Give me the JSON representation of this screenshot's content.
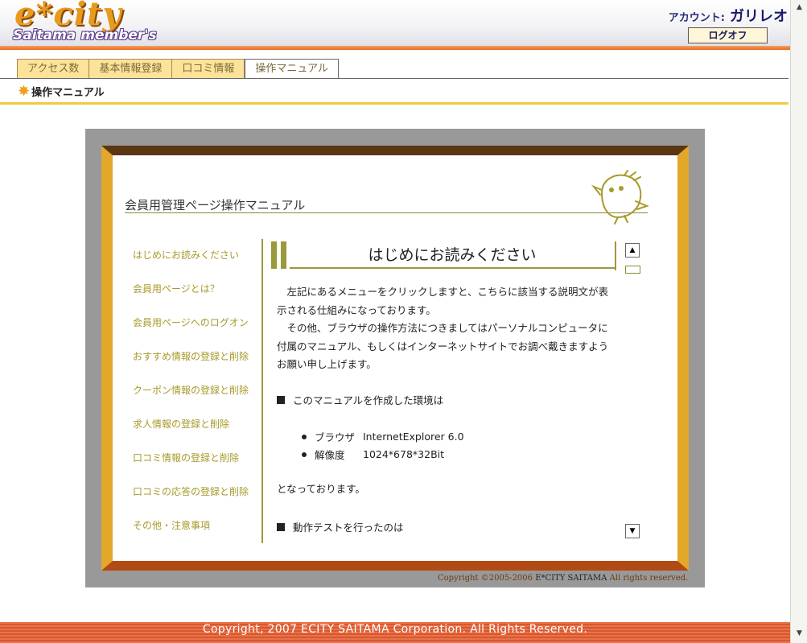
{
  "header": {
    "logo_main": "e*city",
    "logo_sub": "Saitama member's",
    "account_label": "アカウント:",
    "account_name": "ガリレオ",
    "logoff_label": "ログオフ"
  },
  "tabs": [
    {
      "label": "アクセス数"
    },
    {
      "label": "基本情報登録"
    },
    {
      "label": "口コミ情報"
    },
    {
      "label": "操作マニュアル",
      "active": true
    }
  ],
  "page": {
    "title": "操作マニュアル"
  },
  "manual": {
    "title": "会員用管理ページ操作マニュアル",
    "menu": [
      "はじめにお読みください",
      "会員用ページとは？",
      "会員用ページへのログオン",
      "おすすめ情報の登録と削除",
      "クーポン情報の登録と削除",
      "求人情報の登録と削除",
      "口コミ情報の登録と削除",
      "口コミの応答の登録と削除",
      "その他・注意事項"
    ],
    "section_heading": "はじめにお読みください",
    "paragraph": "　左記にあるメニューをクリックしますと、こちらに該当する説明文が表示される仕組みになっております。\n　その他、ブラウザの操作方法につきましてはパーソナルコンピュータに付属のマニュアル、もしくはインターネットサイトでお調べ戴きますようお願い申し上げます。",
    "env_heading": "このマニュアルを作成した環境は",
    "env_items": [
      {
        "key": "ブラウザ",
        "value": "InternetExplorer 6.0"
      },
      {
        "key": "解像度",
        "value": "1024*678*32Bit"
      }
    ],
    "env_closing": "となっております。",
    "test_heading": "動作テストを行ったのは",
    "copyright_prefix": "Copyright ©2005-2006 ",
    "copyright_company": "E*CITY SAITAMA",
    "copyright_suffix": " All rights reserved."
  },
  "footer": {
    "text": "Copyright, 2007 ECITY SAITAMA Corporation. All Rights Reserved."
  },
  "colors": {
    "accent_orange": "#e86a20",
    "tab_yellow": "#fde39a",
    "frame_gold": "#e3a82a",
    "olive": "#9a9a3a"
  }
}
